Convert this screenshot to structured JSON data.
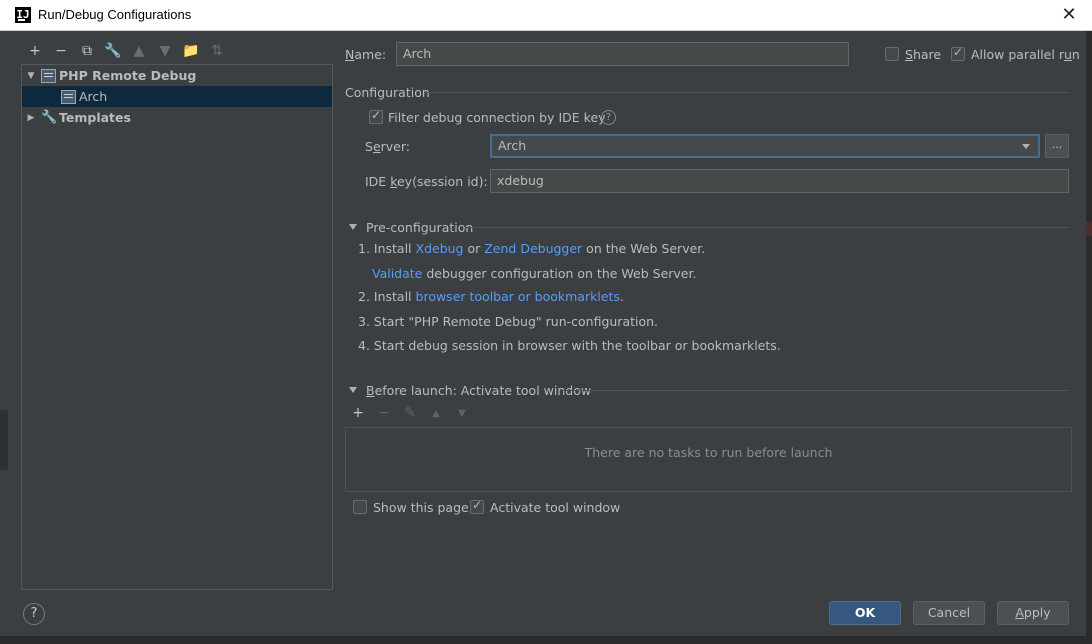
{
  "window": {
    "title": "Run/Debug Configurations",
    "close_glyph": "✕"
  },
  "toolbar": {
    "add": "+",
    "remove": "−",
    "copy": "⧉",
    "edit_defaults": "🔧",
    "move_up": "▲",
    "move_down": "▼",
    "new_folder": "📁",
    "sort": "⇅"
  },
  "tree": {
    "group_label": "PHP Remote Debug",
    "child_label": "Arch",
    "templates_label": "Templates",
    "expanded_glyph": "▼",
    "collapsed_glyph": "▶",
    "php_icon_text": "PHP",
    "wrench_glyph": "🔧"
  },
  "form": {
    "name_label_pre": "",
    "name_label_u": "N",
    "name_label_post": "ame:",
    "name_value": "Arch",
    "share_label_pre": "",
    "share_label_u": "S",
    "share_label_post": "hare",
    "share_checked": false,
    "parallel_label_pre": "Allow parallel r",
    "parallel_label_u": "u",
    "parallel_label_post": "n",
    "parallel_checked": true
  },
  "configuration": {
    "section_label": "Configuration",
    "filter_label": "Filter debug connection by IDE key",
    "filter_checked": true,
    "help_glyph": "?",
    "server_label_pre": "S",
    "server_label_u": "e",
    "server_label_post": "rver:",
    "server_value": "Arch",
    "browse_label": "...",
    "idekey_label_pre": "IDE ",
    "idekey_label_u": "k",
    "idekey_label_post": "ey(session id):",
    "idekey_value": "xdebug"
  },
  "preconfig": {
    "section_label": "Pre-configuration",
    "s1_pre": "1. Install ",
    "s1_link1": "Xdebug",
    "s1_mid": " or ",
    "s1_link2": "Zend Debugger",
    "s1_post": " on the Web Server.",
    "s1b_link": "Validate",
    "s1b_post": " debugger configuration on the Web Server.",
    "s2_pre": "2. Install ",
    "s2_link": "browser toolbar or bookmarklets",
    "s2_post": ".",
    "s3": "3. Start \"PHP Remote Debug\" run-configuration.",
    "s4": "4. Start debug session in browser with the toolbar or bookmarklets."
  },
  "before_launch": {
    "section_label_u": "B",
    "section_label_post": "efore launch: Activate tool window",
    "add": "+",
    "remove": "−",
    "edit": "✎",
    "up": "▲",
    "down": "▼",
    "empty_text": "There are no tasks to run before launch",
    "show_page_label": "Show this page",
    "show_page_checked": false,
    "activate_label": "Activate tool window",
    "activate_checked": true
  },
  "footer": {
    "help": "?",
    "ok": "OK",
    "cancel": "Cancel",
    "apply_u": "A",
    "apply_post": "pply"
  },
  "colors": {
    "background": "#3c3f41",
    "selection": "#0d293e",
    "link": "#589df6",
    "primary_button": "#365880"
  }
}
